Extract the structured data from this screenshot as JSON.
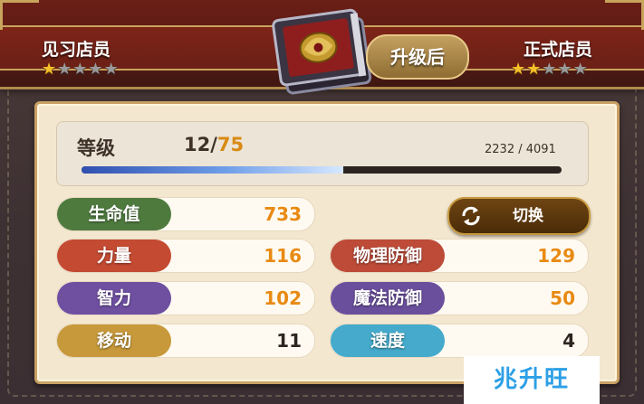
{
  "header": {
    "current_rank": "见习店员",
    "current_stars": "★★★★★",
    "current_stars_filled": 1,
    "next_rank": "正式店员",
    "next_stars": "★★★★★",
    "next_stars_filled": 2,
    "stars_total": 5,
    "upgrade_label": "升级后"
  },
  "level": {
    "label": "等级",
    "current": "12/",
    "max": "75",
    "exp_text": "2232 / 4091",
    "exp_fraction": 0.546
  },
  "switch_button": {
    "label": "切换",
    "icon": "refresh-icon"
  },
  "stats": {
    "hp": {
      "label": "生命值",
      "value": "733",
      "color": "#4e7a3e"
    },
    "strength": {
      "label": "力量",
      "value": "116",
      "color": "#c44a32"
    },
    "intelligence": {
      "label": "智力",
      "value": "102",
      "color": "#6e4fa0"
    },
    "movement": {
      "label": "移动",
      "value": "11",
      "color": "#c7993a"
    },
    "physical_defense": {
      "label": "物理防御",
      "value": "129",
      "color": "#bd4b38"
    },
    "magic_defense": {
      "label": "魔法防御",
      "value": "50",
      "color": "#6a4f9c"
    },
    "speed": {
      "label": "速度",
      "value": "4",
      "color": "#45aacb"
    }
  },
  "watermark": {
    "text": "兆升旺"
  },
  "colors": {
    "accent_gold": "#c9a45c",
    "value_orange": "#e88a12",
    "header_red": "#6b2016"
  }
}
